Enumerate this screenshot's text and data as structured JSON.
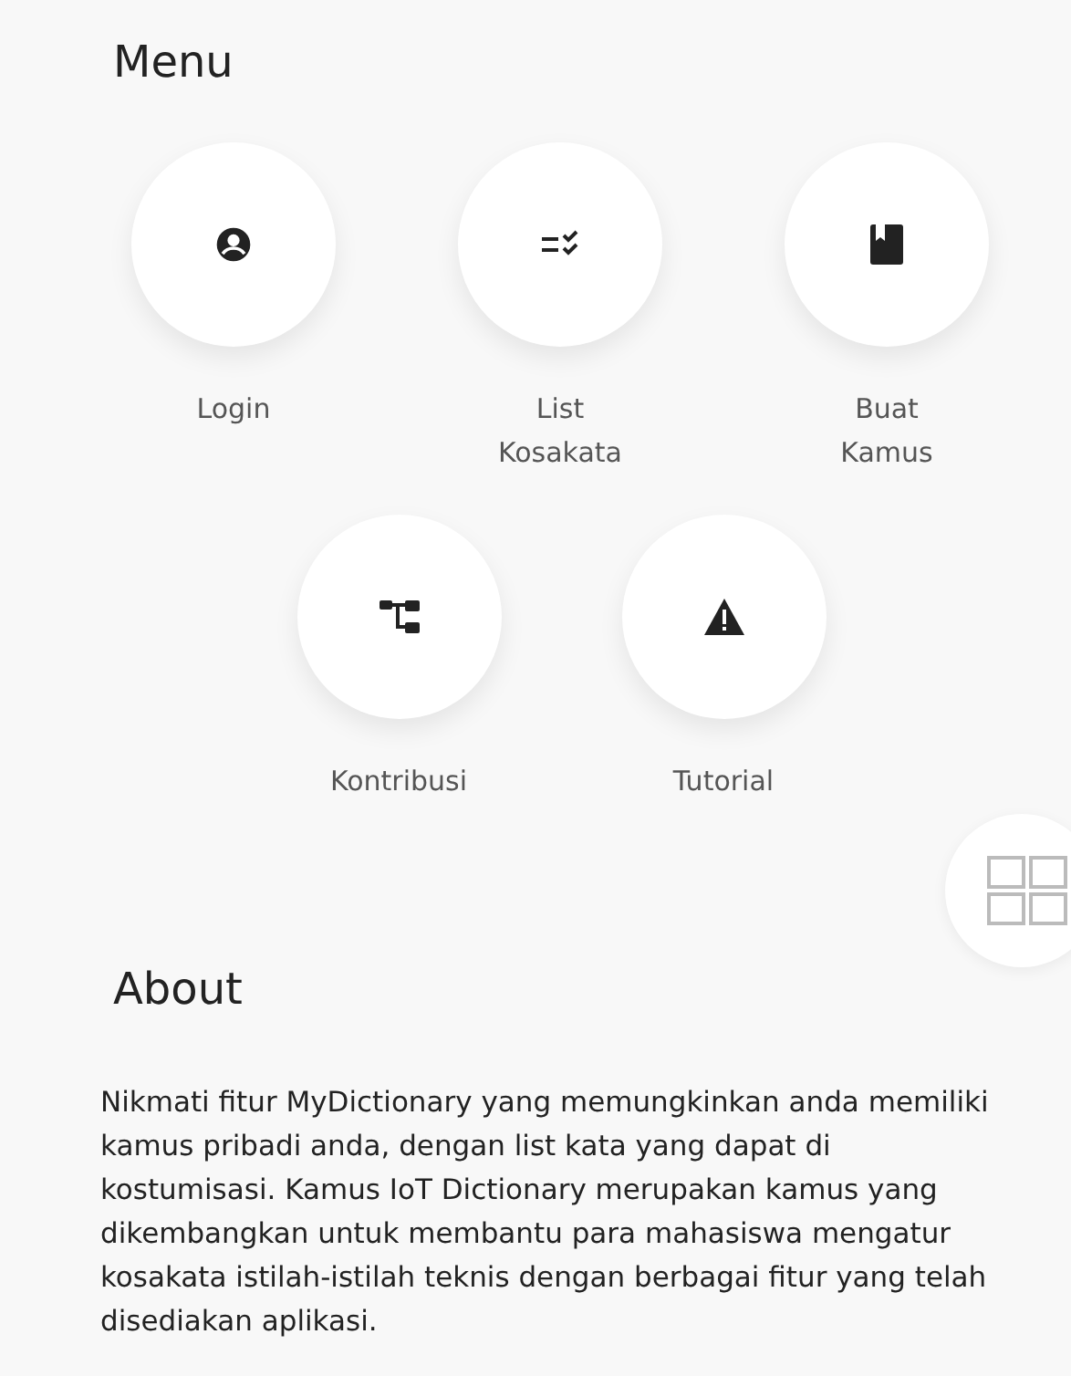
{
  "menu": {
    "title": "Menu",
    "rows": [
      [
        {
          "label": "Login"
        },
        {
          "label": "List Kosakata"
        },
        {
          "label": "Buat Kamus"
        }
      ],
      [
        {
          "label": "Kontribusi"
        },
        {
          "label": "Tutorial"
        }
      ]
    ]
  },
  "about": {
    "title": "About",
    "text": "Nikmati fitur MyDictionary yang memungkinkan anda memiliki kamus pribadi anda, dengan list kata yang dapat di kostumisasi. Kamus IoT Dictionary merupakan kamus yang dikembangkan untuk membantu para mahasiswa mengatur kosakata istilah-istilah teknis dengan berbagai fitur yang telah disediakan aplikasi."
  }
}
